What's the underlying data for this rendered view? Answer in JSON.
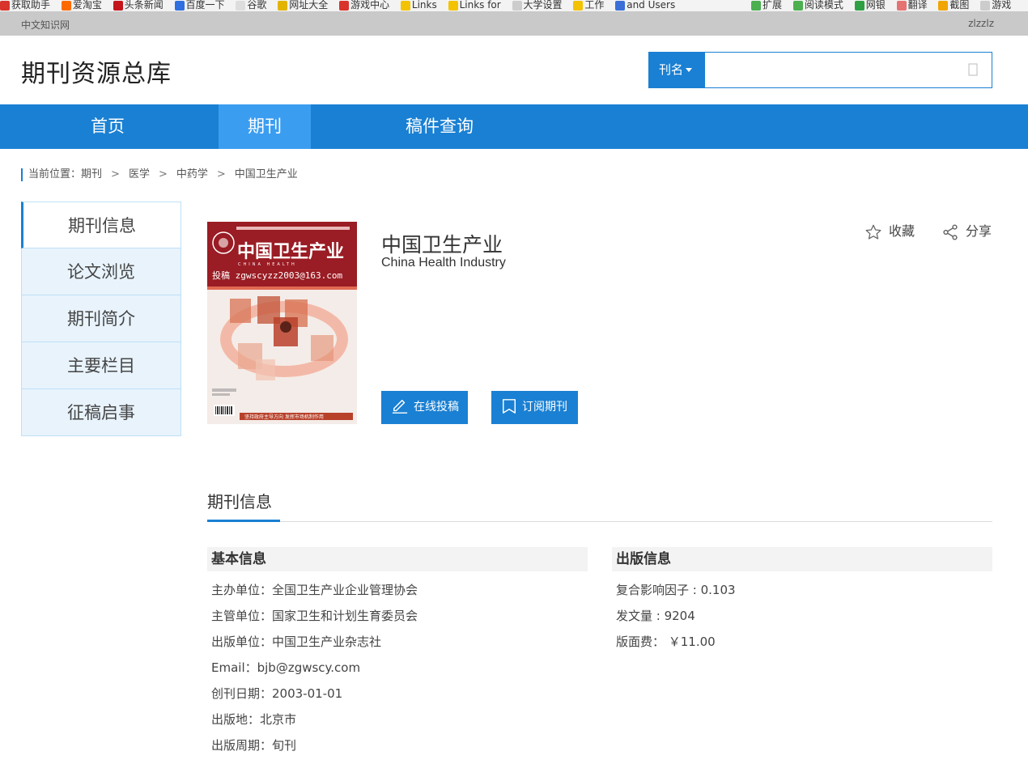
{
  "browser": {
    "bookmarks": [
      "获取助手",
      "爱淘宝",
      "头条新闻",
      "百度一下",
      "谷歌",
      "网址大全",
      "游戏中心",
      "Links",
      "Links for",
      "大学设置",
      "工作",
      "and Users",
      "扩展",
      "阅读模式",
      "网银",
      "翻译",
      "截图",
      "游戏"
    ]
  },
  "topbar": {
    "site": "中文知识网",
    "user": "zlzzlz"
  },
  "header": {
    "title": "期刊资源总库",
    "search_scope": "刊名",
    "search_placeholder": "",
    "search_value": ""
  },
  "nav": {
    "items": [
      "首页",
      "期刊",
      "稿件查询"
    ],
    "active": "期刊"
  },
  "breadcrumb": {
    "prefix": "当前位置：",
    "items": [
      "期刊",
      "医学",
      "中药学",
      "中国卫生产业"
    ]
  },
  "sidebar": {
    "items": [
      "期刊信息",
      "论文浏览",
      "期刊简介",
      "主要栏目",
      "征稿启事"
    ]
  },
  "journal": {
    "title": "中国卫生产业",
    "title_en": "China Health Industry",
    "cover": {
      "title": "中国卫生产业",
      "subtitle": "CHINA HEALTH",
      "email_banner": "投稿 zgwscyzz2003@163.com",
      "slogan": "坚持政府主导方向  发挥市场机制作用"
    }
  },
  "actions": {
    "favorite": "收藏",
    "share": "分享",
    "submit": "在线投稿",
    "subscribe": "订阅期刊"
  },
  "info": {
    "section_title": "期刊信息",
    "basic": {
      "heading": "基本信息",
      "rows": [
        "主办单位：全国卫生产业企业管理协会",
        "主管单位：国家卫生和计划生育委员会",
        "出版单位：中国卫生产业杂志社",
        "Email：bjb@zgwscy.com",
        "创刊日期：2003-01-01",
        "出版地：北京市",
        "出版周期：旬刊"
      ]
    },
    "publish": {
      "heading": "出版信息",
      "rows": [
        "复合影响因子 : 0.103",
        "发文量 : 9204",
        "版面费： ￥11.00"
      ]
    }
  },
  "colors": {
    "primary": "#1a80d3",
    "nav_active": "#3b9df0",
    "side_bg": "#e8f3fc",
    "cover_red": "#9a1c24"
  }
}
